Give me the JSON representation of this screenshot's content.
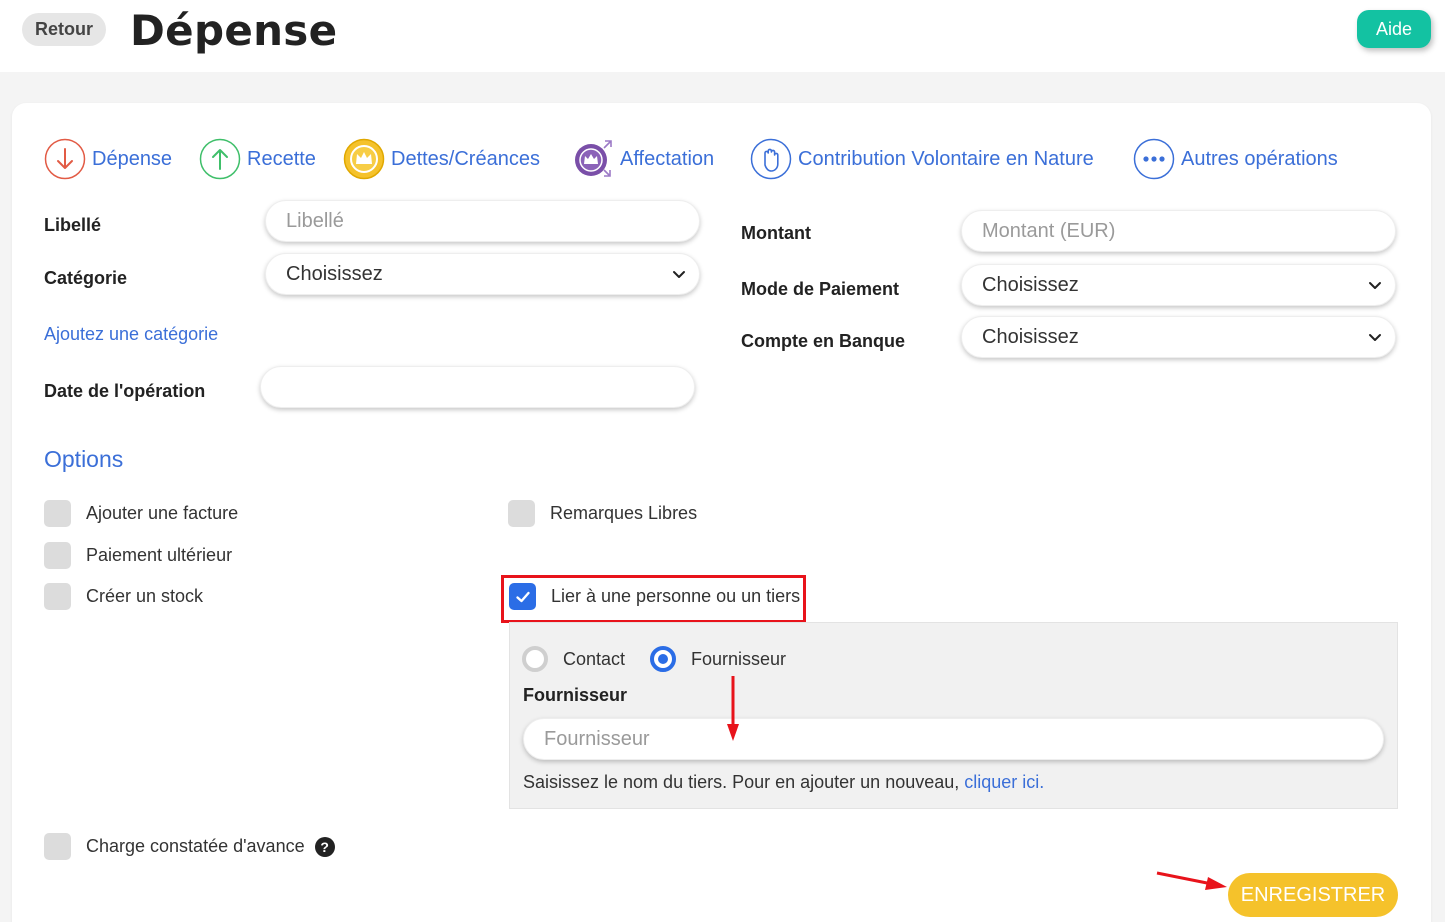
{
  "header": {
    "back_label": "Retour",
    "title": "Dépense",
    "help_label": "Aide"
  },
  "operation_tabs": [
    {
      "label": "Dépense",
      "icon": "arrow-down-icon",
      "color": "#e25b45"
    },
    {
      "label": "Recette",
      "icon": "arrow-up-icon",
      "color": "#3fbf6a"
    },
    {
      "label": "Dettes/Créances",
      "icon": "crown-icon",
      "color": "#f5c22b"
    },
    {
      "label": "Affectation",
      "icon": "crown-transfer-icon",
      "color": "#7a4fa8"
    },
    {
      "label": "Contribution Volontaire en Nature",
      "icon": "hand-icon",
      "color": "#3b6fd8"
    },
    {
      "label": "Autres opérations",
      "icon": "more-dots-icon",
      "color": "#3b6fd8"
    }
  ],
  "form": {
    "libelle_label": "Libellé",
    "libelle_placeholder": "Libellé",
    "categorie_label": "Catégorie",
    "categorie_value": "Choisissez",
    "add_category_link": "Ajoutez une catégorie",
    "date_label": "Date de l'opération",
    "date_value": "",
    "montant_label": "Montant",
    "montant_placeholder": "Montant (EUR)",
    "mode_paiement_label": "Mode de Paiement",
    "mode_paiement_value": "Choisissez",
    "compte_label": "Compte en Banque",
    "compte_value": "Choisissez"
  },
  "options": {
    "title": "Options",
    "ajouter_facture": "Ajouter une facture",
    "paiement_ulterieur": "Paiement ultérieur",
    "creer_stock": "Créer un stock",
    "remarques_libres": "Remarques Libres",
    "lier_tiers": "Lier à une personne ou un tiers",
    "lier_tiers_checked": true,
    "charge_constatee": "Charge constatée d'avance",
    "charge_help": "?"
  },
  "tiers": {
    "contact_label": "Contact",
    "fournisseur_label": "Fournisseur",
    "selected": "Fournisseur",
    "field_label": "Fournisseur",
    "field_placeholder": "Fournisseur",
    "help_prefix": "Saisissez le nom du tiers. Pour en ajouter un nouveau, ",
    "help_link": "cliquer ici."
  },
  "actions": {
    "save_label": "ENREGISTRER"
  },
  "colors": {
    "accent_blue": "#3b6fd8",
    "save_yellow": "#f5c22b",
    "help_green": "#13c2a2",
    "annotation_red": "#e8131b"
  }
}
